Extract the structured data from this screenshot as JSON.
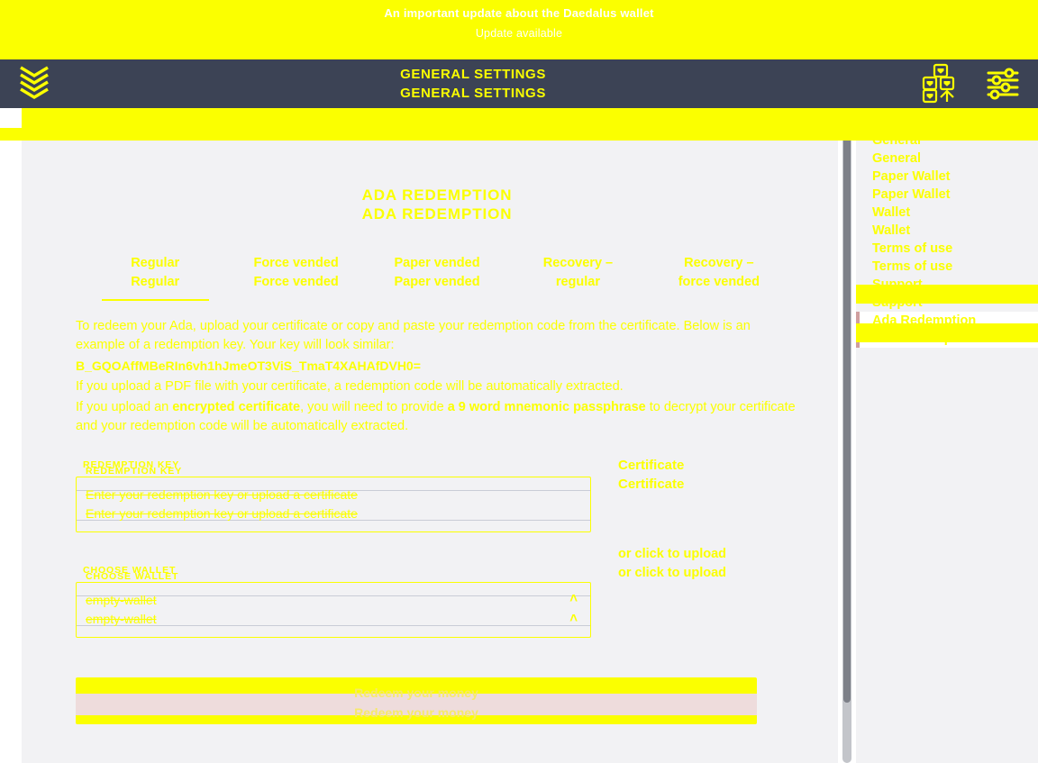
{
  "news_banner": {
    "headline": "An important update about the Daedalus wallet",
    "subline": "Update available"
  },
  "topbar": {
    "title": "General Settings",
    "title_repeat": "General Settings",
    "logo_icon": "daedalus-logo-icon",
    "icons": [
      {
        "name": "network-status-icon",
        "glyph": "wallet-grid"
      },
      {
        "name": "settings-sliders-icon",
        "glyph": "sliders"
      }
    ]
  },
  "main": {
    "page_title": "Ada Redemption",
    "page_title_repeat": "Ada Redemption",
    "tabs": [
      {
        "label_line1": "Regular",
        "label_line2": "Regular",
        "active": true
      },
      {
        "label_line1": "Force vended",
        "label_line2": "Force vended",
        "active": false
      },
      {
        "label_line1": "Paper vended",
        "label_line2": "Paper vended",
        "active": false
      },
      {
        "label_line1": "Recovery –",
        "label_line2": "regular",
        "active": false
      },
      {
        "label_line1": "Recovery –",
        "label_line2": "force vended",
        "active": false
      }
    ],
    "paragraph_1": "To redeem your Ada, upload your certificate or copy and paste your redemption code from the certificate. Below is an example of a redemption key. Your key will look similar:",
    "redemption_key_example": "B_GQOAffMBeRIn6vh1hJmeOT3ViS_TmaT4XAHAfDVH0=",
    "paragraph_2": "If you upload a PDF file with your certificate, a redemption code will be automatically extracted.",
    "paragraph_3_pre": "If you upload an ",
    "paragraph_3_bold1": "encrypted certificate",
    "paragraph_3_mid": ", you will need to provide ",
    "paragraph_3_bold2": "a 9 word mnemonic passphrase",
    "paragraph_3_post": " to decrypt your certificate and your redemption code will be automatically extracted.",
    "fields": {
      "redemption_key": {
        "label": "Redemption key",
        "label_repeat": "Redemption key",
        "placeholder": "Enter your redemption key or upload a certificate",
        "placeholder_repeat": "Enter your redemption key or upload a certificate",
        "value": ""
      },
      "choose_wallet": {
        "label": "Choose wallet",
        "label_repeat": "Choose wallet",
        "value": "empty-wallet",
        "value_repeat": "empty-wallet",
        "chevron": "˄",
        "options": [
          "empty-wallet"
        ]
      }
    },
    "certificate": {
      "title": "Certificate",
      "title_repeat": "Certificate",
      "upload_hint": "or click to upload",
      "upload_hint_repeat": "or click to upload"
    },
    "submit": {
      "label": "Redeem your money",
      "label_repeat": "Redeem your money",
      "disabled": true
    }
  },
  "sidebar": {
    "items": [
      {
        "label": "General",
        "active": false
      },
      {
        "label": "General",
        "active": false
      },
      {
        "label": "Paper Wallet",
        "active": false
      },
      {
        "label": "Paper Wallet",
        "active": false
      },
      {
        "label": "Wallet",
        "active": false
      },
      {
        "label": "Wallet",
        "active": false
      },
      {
        "label": "Terms of use",
        "active": false
      },
      {
        "label": "Terms of use",
        "active": false
      },
      {
        "label": "Support",
        "active": false
      },
      {
        "label": "Support",
        "active": false
      },
      {
        "label": "Ada Redemption",
        "active": true
      },
      {
        "label": "Ada Redemption",
        "active": true
      }
    ]
  },
  "colors": {
    "accent_yellow": "#fbff00",
    "topbar_navy": "#3c4355",
    "page_grey": "#f2f2f4",
    "active_bar": "#cf9f9f",
    "disabled_btn": "#eedcdc"
  },
  "scrollbar": {
    "name": "vertical-scrollbar",
    "position_percent": 2
  }
}
